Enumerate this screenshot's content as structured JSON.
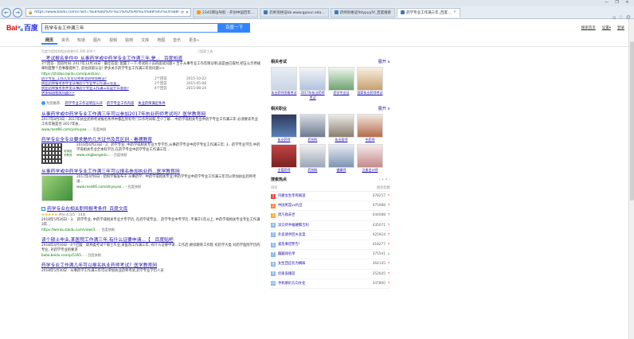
{
  "browser": {
    "url": "https://www.baidu.com/s?wd=%E8%8D%AF%E5%AD%A6%E4%B8%93%E4%B8%9A%E5%B7%A5%E4%BD%9C%E6%BB%A1%E4%B8%89%E5%B9%B4",
    "tabs": [
      {
        "label": "2345网址导航 - 开创中国百年...",
        "color": "#f39a1e"
      },
      {
        "label": "药师资格证kb.www.gpouc.edu...",
        "color": "#3b78c5"
      },
      {
        "label": "药师资格证fbtypyp5f_百度搜索",
        "color": "#3b78c5"
      },
      {
        "label": "药学专业工作满三年_百度...",
        "color": "#3b78c5",
        "active": true
      }
    ],
    "window_buttons": [
      "—",
      "❐",
      "✕"
    ]
  },
  "header": {
    "logo_bai": "Bai",
    "logo_paw": "🐾",
    "logo_cn": "百度",
    "query": "药学专业工作满三年",
    "search_button": "百度一下",
    "top_links": [
      "搜索首页",
      "设置▾",
      "登录"
    ]
  },
  "nav_tabs": [
    "网页",
    "资讯",
    "知道",
    "图片",
    "视频",
    "贴吧",
    "文库",
    "地图",
    "音乐",
    "更多»"
  ],
  "stats": {
    "count": "百度为您找到相关结果约2,390,000个",
    "tool": "▽搜索工具"
  },
  "results": [
    {
      "title": "...考试报名条件中_从事药学或中药学专业工作满三年,是... _百度知道",
      "abstract": "3个回答 · 回答时间: 2017年12月16日 · 最佳答案: 配置了一下,考试的人员的面试问题+  至于从事专业工作年限证明,就是由已取时,把五公示用规章制度整个后事都提供了, 前往获取认证!  更多关于药学专业工作满三年的问题>>",
      "url": "https://zhidao.baidu.com/question/...",
      "sub": [
        {
          "t": "药学专业_工作几年可以考执业药师资格证?",
          "a": "2个回答",
          "d": "2015-10-22"
        },
        {
          "t": "执业药师报考条件里从事药学专业中工作满三年是...",
          "a": "2个回答",
          "d": "2015-05-08"
        },
        {
          "t": "执业药师报考条件里从事药学专业工作满三年是什么意思?",
          "a": "4个回答",
          "d": "2015-08-24"
        }
      ],
      "more": "更多知道相关问题>>"
    },
    {
      "recs_label": "为您推荐:",
      "recs": [
        "药学专业工作证明怎么开",
        "药学专业工作内容",
        "执业药师满足条件"
      ]
    },
    {
      "title": "从事药学或中药学专业工作满三年可以参加2017年执业药师考试吗?_医学教育网",
      "abstract": "2017年8月3日 - 2017年执业药师考试报名条件中都应到有专门工作时间和,至少了解... 中药学或相关专业中药学专业工作满三年 必须要去专业工作年限是否 2017年执...",
      "url": "www.med66.com/yishuyao...",
      "snap": "百度快照"
    },
    {
      "title": "药学专业全专业要求是的几大证书及其区别 - 看德教育",
      "abstract": "2016年6月23日 - 2、药学专业, 中药学或相关专业大专学历,从事药学专业中药学专业工作满三年; 3、药学专业学历,中药学或相关专业全本科学历,在药学专业中药学专业工作满三年...",
      "url": "www.xingbengedu...",
      "snap": "百度快照",
      "has_qr": true,
      "qr_side": "哈佛医学教育"
    },
    {
      "title": "从事药学或中药学专业工作满三年可以报名参加执业药...医学教育网",
      "abstract": "2017年4月6日 - 结构学报发布于 从事药学、中药学或相关专业,中药学专业中药学专业工作满三年可以参加执业药师考试...",
      "url": "www.med66.com/zhiyeyao...",
      "snap": "百度快照",
      "has_thumb": true
    },
    {
      "title": "药学专业在相关职称报考条件_百度文库",
      "checkbox": true,
      "stars": "★★★★★",
      "rating": "评分:4.5/5 · 14页",
      "abstract": "2018年5月26日 - 3、 药学专业, 中药学或相关专业大专学历, 在药学或专业... 药学专业中专学历, 不满于1年以上, 中药学或相关专业专业工作满3年...",
      "url": "https://wenku.baidu.com/view/3...",
      "snap": "百度快照"
    },
    {
      "title": "读个硕士毕业,某医院工作满三年,有什么证要申请...【__百度贴吧",
      "abstract": "2018年4月16日 - 4个回复 · 职称类考试个硕士毕业,某医院工作满三年, 有什么证要申请...工作后,继续教育工作院 有药学大类 对药学医院学历的专业, 对药学专业的要求",
      "url": "baba.baidu.com/p/5165...",
      "snap": "百度快照"
    },
    {
      "title": "药学专业工作满几年可以报名执业药师考试?_医学教育网",
      "abstract": "2018年5月30日 - 从事药学工作满三年可以参加执业药师考试,药学专业学历人员",
      "url": "",
      "snap": ""
    }
  ],
  "side": {
    "exams_title": "相关考试",
    "exams_expand": "展开 ∨",
    "exams": [
      "执业药师资格考试",
      "2017年执业药师考试",
      "药学专业证",
      "国家执业药师考试"
    ],
    "jobs_title": "相关职业",
    "jobs_expand": "展开 ∨",
    "jobs": [
      "执业药师",
      "药剂科",
      "执业医师",
      "中药师",
      "主管药师",
      "药剂科",
      "健康师",
      "注册会计师"
    ],
    "hot_title": "搜索热点",
    "hot_pager": "‹ • • ›",
    "hot_col_name": "排名",
    "hot_col_val": "搜索指数",
    "hot": [
      {
        "kw": "内蒙女生李挥楠逃",
        "num": "478257",
        "dir": "up"
      },
      {
        "kw": "中国男篮vs约旦",
        "num": "475988",
        "dir": "up"
      },
      {
        "kw": "周乃勋去世",
        "num": "444088",
        "dir": "up"
      },
      {
        "kw": "深交所手幅硬腾吉利",
        "num": "435071",
        "dir": "up"
      },
      {
        "kw": "外卖骑手回乡卖菜",
        "num": "425924",
        "dir": "up"
      },
      {
        "kw": "紧急事官警告!",
        "num": "418277",
        "dir": "up"
      },
      {
        "kw": "蹦蹦闯名单",
        "num": "375541",
        "dir": "down"
      },
      {
        "kw": "女生回应名为横嫁",
        "num": "364145",
        "dir": "up"
      },
      {
        "kw": "优质直播首",
        "num": "352645",
        "dir": "up"
      },
      {
        "kw": "手机喇叭方向文化",
        "num": "347800",
        "dir": "up"
      }
    ]
  }
}
